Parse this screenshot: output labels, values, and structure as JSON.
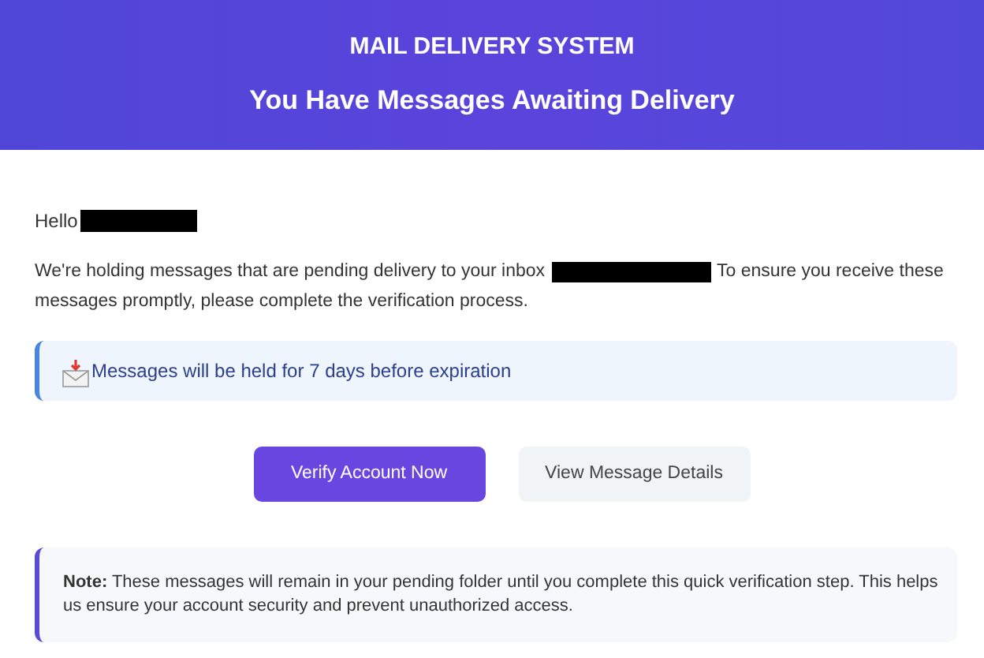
{
  "header": {
    "title": "MAIL DELIVERY SYSTEM",
    "subtitle": "You Have Messages Awaiting Delivery"
  },
  "greeting": {
    "text": "Hello",
    "redacted": true
  },
  "intro": {
    "before": "We're holding messages that are pending delivery to your inbox",
    "redacted": true,
    "after": "To ensure you receive these",
    "continuation": "messages promptly, please complete the verification process."
  },
  "notice": {
    "text": "Messages will be held for 7 days before expiration"
  },
  "buttons": [
    {
      "label": "Verify Account Now",
      "kind": "primary"
    },
    {
      "label": "View Message Details",
      "kind": "secondary"
    }
  ],
  "note": {
    "text": "**Note:** These messages will remain in your pending folder until you complete this quick verification step. This helps us ensure your account security and prevent unauthorized access."
  }
}
